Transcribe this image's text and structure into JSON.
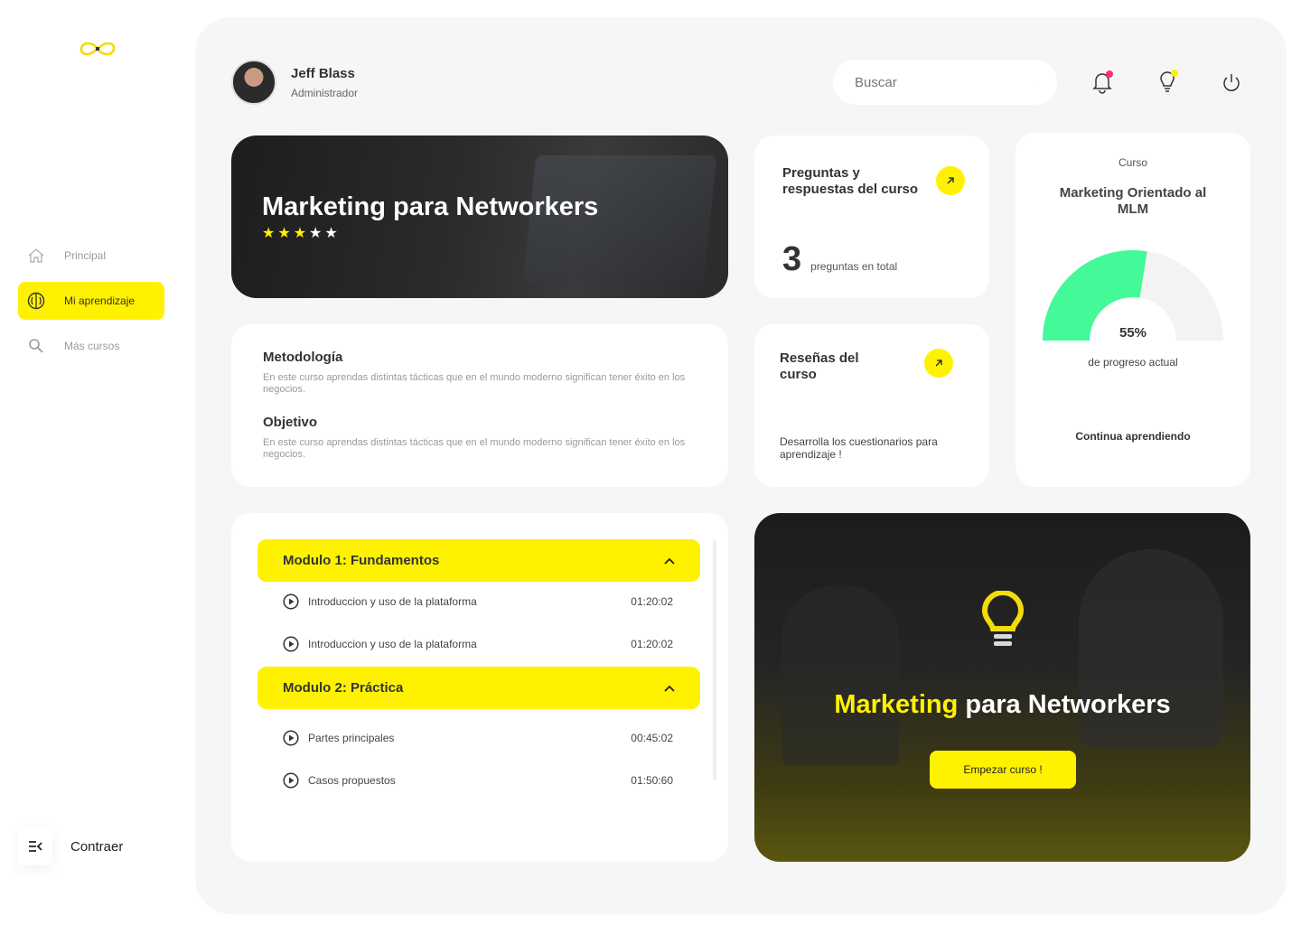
{
  "sidebar": {
    "items": [
      {
        "label": "Principal",
        "icon": "home-icon",
        "active": false
      },
      {
        "label": "Mi aprendizaje",
        "icon": "brain-icon",
        "active": true
      },
      {
        "label": "Más cursos",
        "icon": "search-icon",
        "active": false
      }
    ],
    "collapse_label": "Contraer"
  },
  "header": {
    "user_name": "Jeff Blass",
    "user_role": "Administrador",
    "search_placeholder": "Buscar",
    "notification_dot_color": "#ff2d6f",
    "idea_dot_color": "#fff200"
  },
  "hero": {
    "title": "Marketing para Networkers",
    "rating": 3,
    "rating_max": 5
  },
  "qa": {
    "title": "Preguntas y respuestas del curso",
    "count": "3",
    "count_label": "preguntas en total"
  },
  "progress": {
    "kicker": "Curso",
    "course_title": "Marketing Orientado al MLM",
    "percent": 55,
    "percent_label": "55%",
    "progress_label": "de progreso actual",
    "continue_label": "Continua aprendiendo"
  },
  "info": {
    "methodology_title": "Metodología",
    "methodology_text": "En este curso aprendas distintas tácticas que en el mundo moderno significan tener éxito en los negocios.",
    "objective_title": "Objetivo",
    "objective_text": "En este curso aprendas distintas tácticas que en el mundo moderno significan tener éxito en los negocios."
  },
  "reviews": {
    "title": "Reseñas del curso",
    "desc": "Desarrolla los cuestionarios para aprendizaje !"
  },
  "modules": [
    {
      "title": "Modulo 1: Fundamentos",
      "lessons": [
        {
          "name": "Introduccion y uso de la plataforma",
          "duration": "01:20:02"
        },
        {
          "name": "Introduccion y uso de la plataforma",
          "duration": "01:20:02"
        }
      ]
    },
    {
      "title": "Modulo 2: Práctica",
      "lessons": [
        {
          "name": "Partes principales",
          "duration": "00:45:02"
        },
        {
          "name": "Casos propuestos",
          "duration": "01:50:60"
        }
      ]
    }
  ],
  "promo": {
    "title_highlight": "Marketing",
    "title_rest": " para Networkers",
    "button_label": "Empezar curso !"
  },
  "colors": {
    "accent": "#fff200",
    "progress": "#44f998",
    "background": "#f6f6f6"
  }
}
